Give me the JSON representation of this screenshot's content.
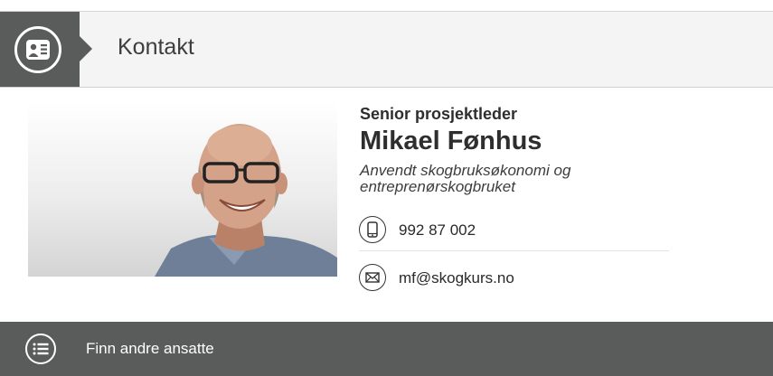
{
  "header": {
    "title": "Kontakt",
    "icon": "contact-card-icon"
  },
  "person": {
    "role": "Senior prosjektleder",
    "name": "Mikael Fønhus",
    "department": "Anvendt skogbruksøkonomi og entreprenørskogbruket",
    "photo": "portrait-photo"
  },
  "contact": {
    "phone": {
      "icon": "phone-icon",
      "value": "992 87 002"
    },
    "email": {
      "icon": "mail-icon",
      "value": "mf@skogkurs.no"
    }
  },
  "footer": {
    "icon": "list-icon",
    "label": "Finn andre ansatte"
  },
  "colors": {
    "dark": "#595c5b",
    "header_bg": "#f4f4f4",
    "text": "#2e2e2e"
  }
}
